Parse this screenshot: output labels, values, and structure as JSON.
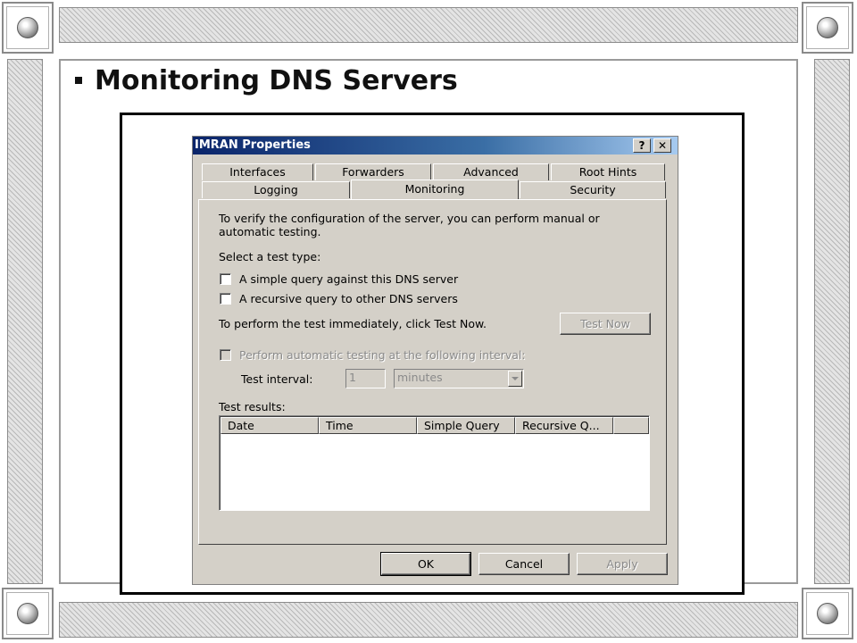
{
  "slide": {
    "title": "Monitoring DNS Servers"
  },
  "dialog": {
    "title": "IMRAN Properties",
    "help_button": "?",
    "close_button": "✕",
    "tabs_row1": [
      "Interfaces",
      "Forwarders",
      "Advanced",
      "Root Hints"
    ],
    "tabs_row2": [
      "Logging",
      "Monitoring",
      "Security"
    ],
    "active_tab": "Monitoring",
    "intro_text_line1": "To verify the configuration of the server, you can perform manual or",
    "intro_text_line2": "automatic testing.",
    "select_test_label": "Select a test type:",
    "simple_query_label": "A simple query against this DNS server",
    "recursive_query_label": "A recursive query to other DNS servers",
    "test_now_text": "To perform the test immediately, click Test Now.",
    "test_now_button": "Test Now",
    "auto_test_label": "Perform automatic testing at the following interval:",
    "test_interval_label": "Test interval:",
    "test_interval_value": "1",
    "interval_unit": "minutes",
    "test_results_label": "Test results:",
    "columns": [
      "Date",
      "Time",
      "Simple Query",
      "Recursive Q..."
    ],
    "ok_button": "OK",
    "cancel_button": "Cancel",
    "apply_button": "Apply"
  },
  "colors": {
    "titlebar_start": "#0a246a",
    "dialog_face": "#d4d0c8",
    "frame_hatch": "#b8b8b8"
  }
}
